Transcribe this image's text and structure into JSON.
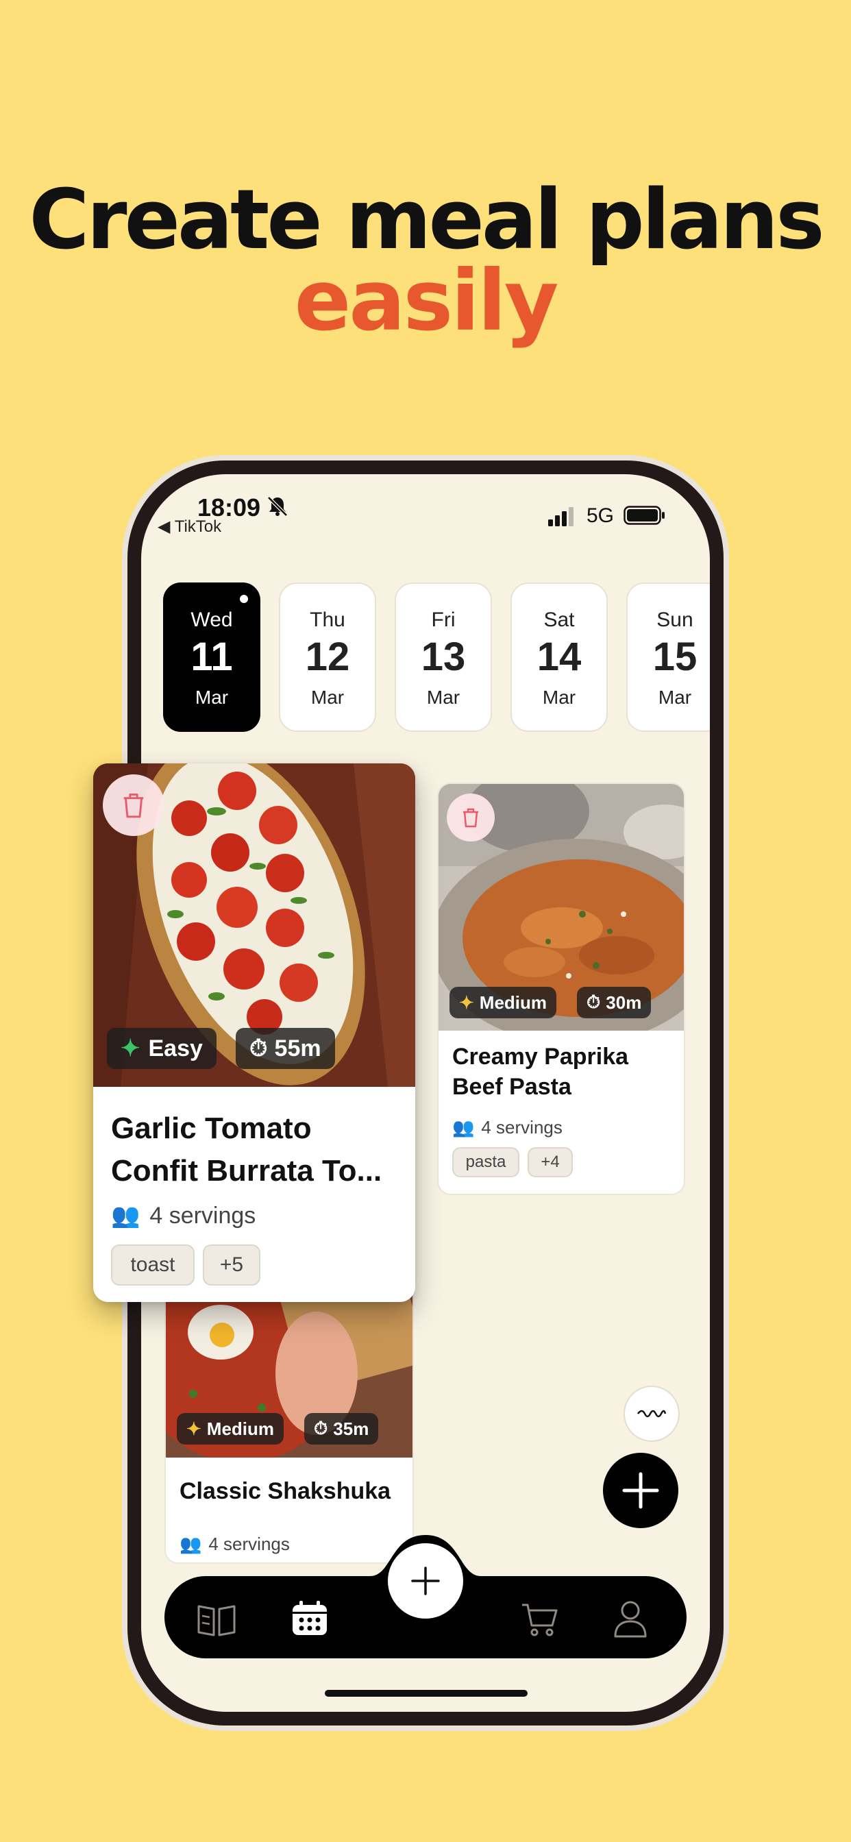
{
  "headline": {
    "line1": "Create meal plans",
    "line2": "easily"
  },
  "status_bar": {
    "time": "18:09",
    "back_app": "◀ TikTok",
    "network": "5G"
  },
  "days": [
    {
      "dow": "Wed",
      "day": "11",
      "month": "Mar",
      "selected": true
    },
    {
      "dow": "Thu",
      "day": "12",
      "month": "Mar",
      "selected": false
    },
    {
      "dow": "Fri",
      "day": "13",
      "month": "Mar",
      "selected": false
    },
    {
      "dow": "Sat",
      "day": "14",
      "month": "Mar",
      "selected": false
    },
    {
      "dow": "Sun",
      "day": "15",
      "month": "Mar",
      "selected": false
    }
  ],
  "recipes": [
    {
      "title": "Garlic Tomato Confit Burrata To...",
      "title_lines": [
        "Garlic Tomato",
        "Confit Burrata To..."
      ],
      "difficulty": "Easy",
      "time": "55m",
      "servings": "4 servings",
      "tags": [
        "toast",
        "+5"
      ]
    },
    {
      "title": "Creamy Paprika Beef Pasta",
      "title_lines": [
        "Creamy Paprika",
        "Beef Pasta"
      ],
      "difficulty": "Medium",
      "time": "30m",
      "servings": "4 servings",
      "tags": [
        "pasta",
        "+4"
      ]
    },
    {
      "title": "Classic Shakshuka",
      "difficulty": "Medium",
      "time": "35m",
      "servings": "4 servings"
    }
  ],
  "tab_bar": {
    "items": [
      "recipes-book-icon",
      "calendar-icon",
      "add-icon",
      "cart-icon",
      "profile-icon"
    ],
    "active": "calendar-icon"
  },
  "colors": {
    "background": "#FDE07A",
    "accent": "#E8582E",
    "screen": "#F8F2E3",
    "easy_star": "#3BC46A",
    "medium_star": "#F5C23C"
  }
}
